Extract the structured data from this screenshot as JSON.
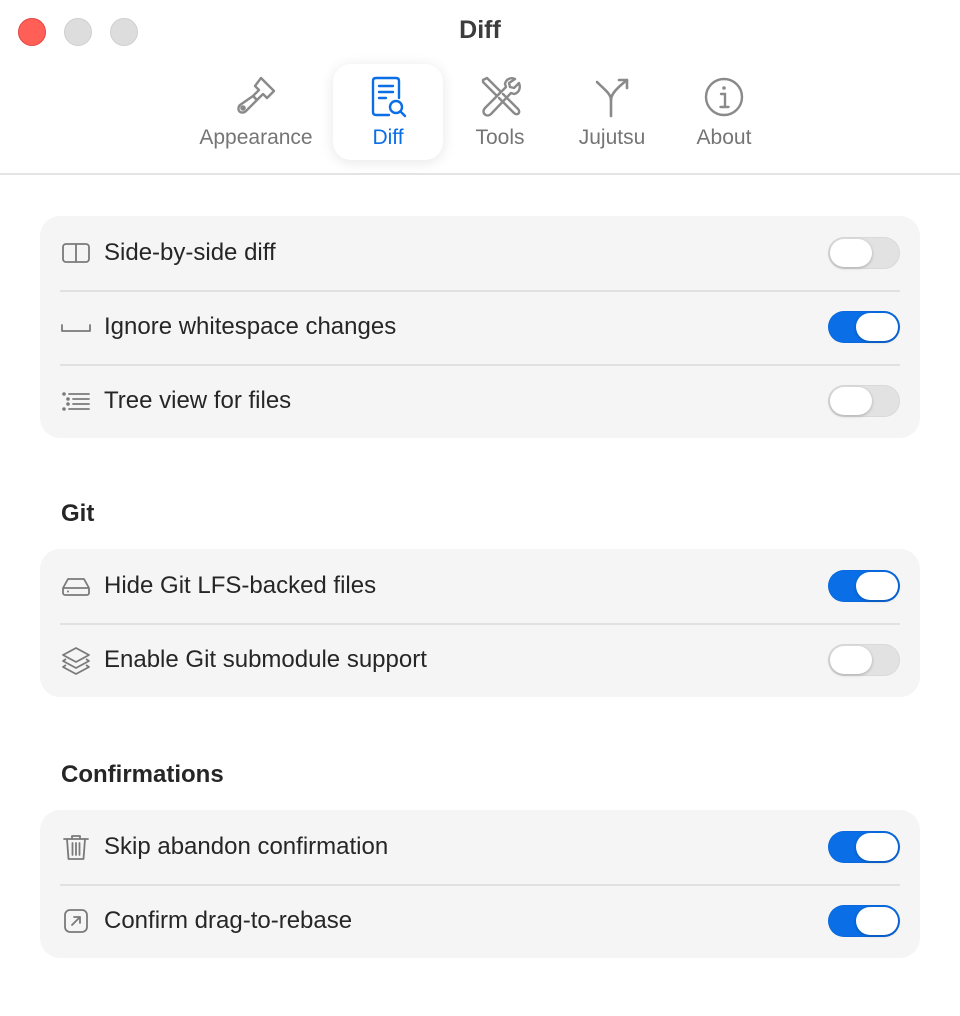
{
  "window": {
    "title": "Diff"
  },
  "tabs": [
    {
      "label": "Appearance",
      "icon": "paintbrush-icon",
      "active": false
    },
    {
      "label": "Diff",
      "icon": "doc-magnifier-icon",
      "active": true
    },
    {
      "label": "Tools",
      "icon": "wrench-screwdriver-icon",
      "active": false
    },
    {
      "label": "Jujutsu",
      "icon": "branch-icon",
      "active": false
    },
    {
      "label": "About",
      "icon": "info-icon",
      "active": false
    }
  ],
  "general": {
    "rows": [
      {
        "label": "Side-by-side diff",
        "icon": "split-view-icon",
        "on": false
      },
      {
        "label": "Ignore whitespace changes",
        "icon": "space-icon",
        "on": true
      },
      {
        "label": "Tree view for files",
        "icon": "tree-list-icon",
        "on": false
      }
    ]
  },
  "git": {
    "title": "Git",
    "rows": [
      {
        "label": "Hide Git LFS-backed files",
        "icon": "drive-icon",
        "on": true
      },
      {
        "label": "Enable Git submodule support",
        "icon": "stack-icon",
        "on": false
      }
    ]
  },
  "confirmations": {
    "title": "Confirmations",
    "rows": [
      {
        "label": "Skip abandon confirmation",
        "icon": "trash-icon",
        "on": true
      },
      {
        "label": "Confirm drag-to-rebase",
        "icon": "arrow-up-right-square-icon",
        "on": true
      }
    ]
  },
  "colors": {
    "accent": "#0a6ee6",
    "toggle_off": "#e2e2e2",
    "close": "#ff5f57"
  }
}
